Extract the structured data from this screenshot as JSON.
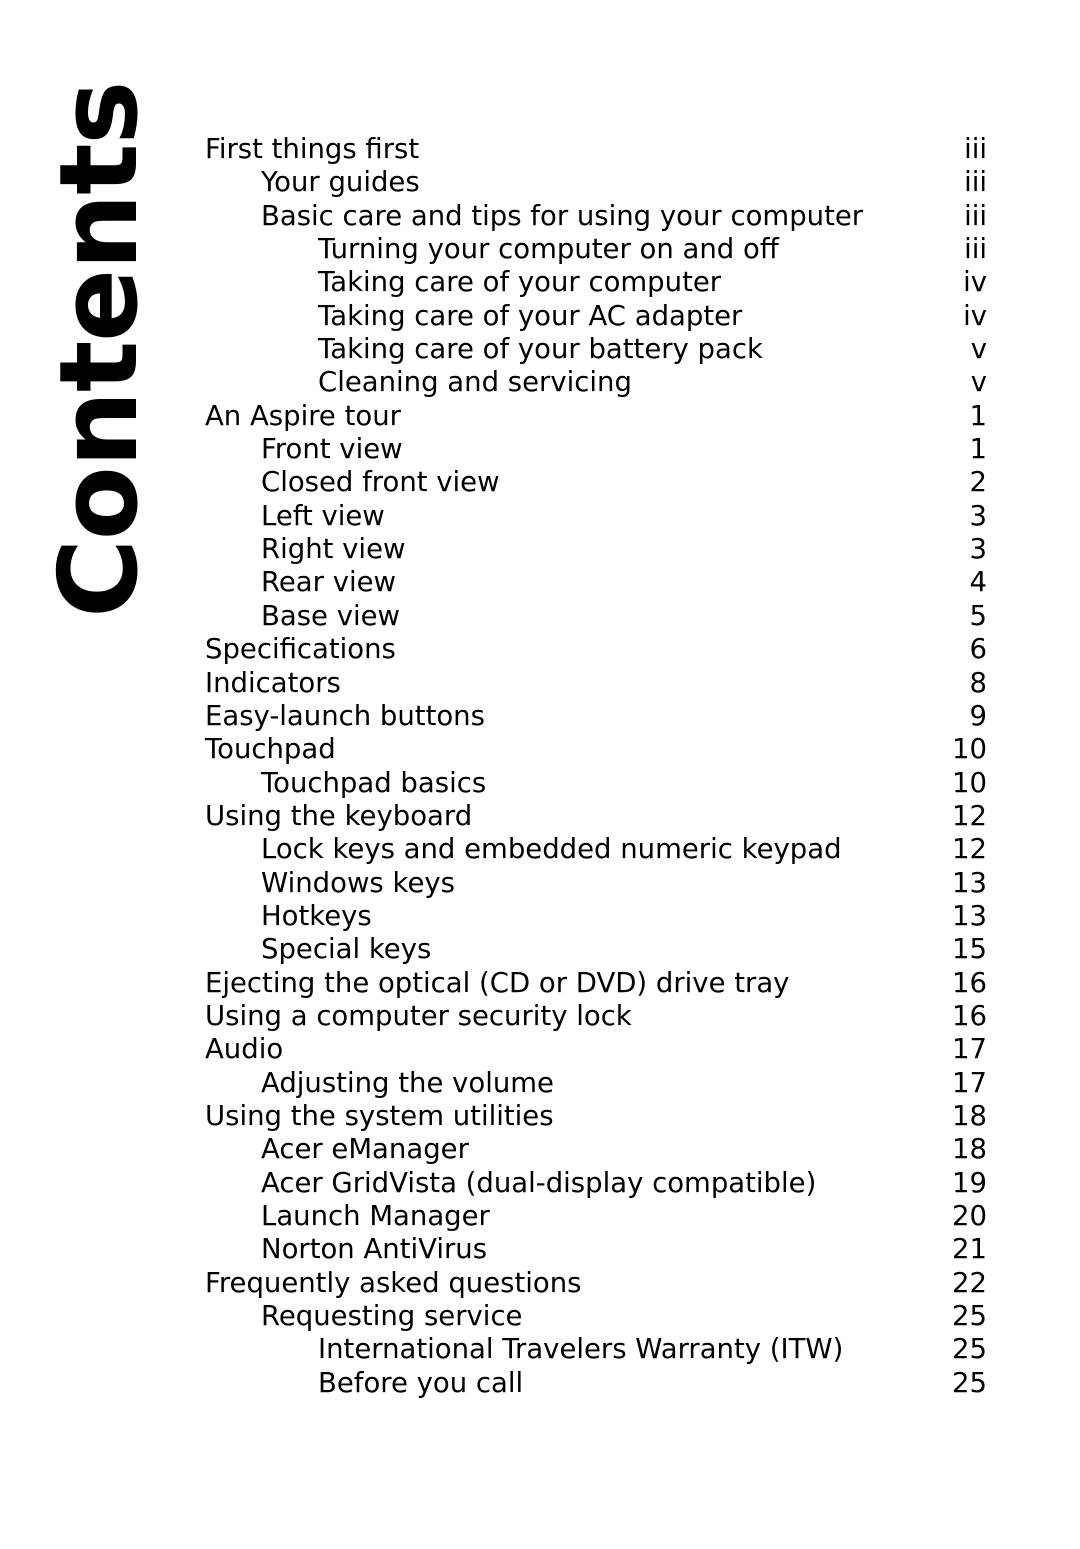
{
  "page": {
    "heading": "Contents",
    "background_color": "#ffffff",
    "text_color": "#000000"
  },
  "toc": {
    "entries": [
      {
        "title": "First things first",
        "page": "iii",
        "level": 0
      },
      {
        "title": "Your guides",
        "page": "iii",
        "level": 1
      },
      {
        "title": "Basic care and tips for using your computer",
        "page": "iii",
        "level": 1
      },
      {
        "title": "Turning your computer on and off",
        "page": "iii",
        "level": 2
      },
      {
        "title": "Taking care of your computer",
        "page": "iv",
        "level": 2
      },
      {
        "title": "Taking care of your AC adapter",
        "page": "iv",
        "level": 2
      },
      {
        "title": "Taking care of your battery pack",
        "page": "v",
        "level": 2
      },
      {
        "title": "Cleaning and servicing",
        "page": "v",
        "level": 2
      },
      {
        "title": "An Aspire tour",
        "page": "1",
        "level": 0
      },
      {
        "title": "Front view",
        "page": "1",
        "level": 1
      },
      {
        "title": "Closed front view",
        "page": "2",
        "level": 1
      },
      {
        "title": "Left view",
        "page": "3",
        "level": 1
      },
      {
        "title": "Right view",
        "page": "3",
        "level": 1
      },
      {
        "title": "Rear view",
        "page": "4",
        "level": 1
      },
      {
        "title": "Base view",
        "page": "5",
        "level": 1
      },
      {
        "title": "Specifications",
        "page": "6",
        "level": 0
      },
      {
        "title": "Indicators",
        "page": "8",
        "level": 0
      },
      {
        "title": "Easy-launch buttons",
        "page": "9",
        "level": 0
      },
      {
        "title": "Touchpad",
        "page": "10",
        "level": 0
      },
      {
        "title": "Touchpad basics",
        "page": "10",
        "level": 1
      },
      {
        "title": "Using the keyboard",
        "page": "12",
        "level": 0
      },
      {
        "title": "Lock keys and embedded numeric keypad",
        "page": "12",
        "level": 1
      },
      {
        "title": "Windows keys",
        "page": "13",
        "level": 1
      },
      {
        "title": "Hotkeys",
        "page": "13",
        "level": 1
      },
      {
        "title": "Special keys",
        "page": "15",
        "level": 1
      },
      {
        "title": "Ejecting the optical (CD or DVD) drive tray",
        "page": "16",
        "level": 0
      },
      {
        "title": "Using a computer security lock",
        "page": "16",
        "level": 0
      },
      {
        "title": "Audio",
        "page": "17",
        "level": 0
      },
      {
        "title": "Adjusting the volume",
        "page": "17",
        "level": 1
      },
      {
        "title": "Using the system utilities",
        "page": "18",
        "level": 0
      },
      {
        "title": "Acer eManager",
        "page": "18",
        "level": 1
      },
      {
        "title": "Acer GridVista (dual-display compatible)",
        "page": "19",
        "level": 1
      },
      {
        "title": "Launch Manager",
        "page": "20",
        "level": 1
      },
      {
        "title": "Norton AntiVirus",
        "page": "21",
        "level": 1
      },
      {
        "title": "Frequently asked questions",
        "page": "22",
        "level": 0
      },
      {
        "title": "Requesting service",
        "page": "25",
        "level": 1
      },
      {
        "title": "International Travelers Warranty (ITW)",
        "page": "25",
        "level": 2
      },
      {
        "title": "Before you call",
        "page": "25",
        "level": 2
      }
    ]
  }
}
